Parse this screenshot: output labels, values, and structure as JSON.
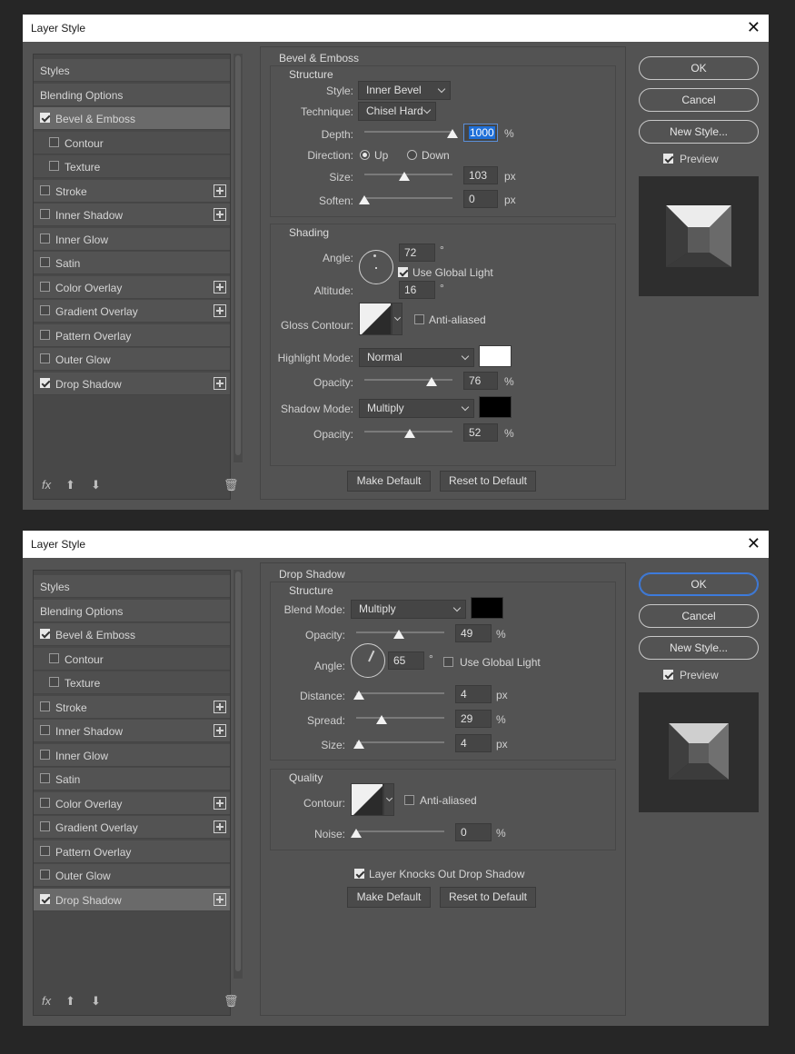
{
  "dialog1": {
    "title": "Layer Style",
    "close_glyph": "✕",
    "styles_list": [
      {
        "label": "Styles"
      },
      {
        "label": "Blending Options"
      },
      {
        "label": "Bevel & Emboss",
        "checked": true,
        "selected": true
      },
      {
        "label": "Contour",
        "checked": false,
        "sub": true
      },
      {
        "label": "Texture",
        "checked": false,
        "sub": true
      },
      {
        "label": "Stroke",
        "checked": false,
        "plus": true
      },
      {
        "label": "Inner Shadow",
        "checked": false,
        "plus": true
      },
      {
        "label": "Inner Glow",
        "checked": false
      },
      {
        "label": "Satin",
        "checked": false
      },
      {
        "label": "Color Overlay",
        "checked": false,
        "plus": true
      },
      {
        "label": "Gradient Overlay",
        "checked": false,
        "plus": true
      },
      {
        "label": "Pattern Overlay",
        "checked": false
      },
      {
        "label": "Outer Glow",
        "checked": false
      },
      {
        "label": "Drop Shadow",
        "checked": true,
        "plus": true
      }
    ],
    "fx_label": "fx",
    "section_title": "Bevel & Emboss",
    "structure": {
      "title": "Structure",
      "style_label": "Style:",
      "style_value": "Inner Bevel",
      "technique_label": "Technique:",
      "technique_value": "Chisel Hard",
      "depth_label": "Depth:",
      "depth_value": "1000",
      "depth_unit": "%",
      "direction_label": "Direction:",
      "direction_up": "Up",
      "direction_down": "Down",
      "size_label": "Size:",
      "size_value": "103",
      "size_unit": "px",
      "soften_label": "Soften:",
      "soften_value": "0",
      "soften_unit": "px"
    },
    "shading": {
      "title": "Shading",
      "angle_label": "Angle:",
      "angle_value": "72",
      "degree": "°",
      "global_light": "Use Global Light",
      "altitude_label": "Altitude:",
      "altitude_value": "16",
      "gloss_label": "Gloss Contour:",
      "anti_aliased": "Anti-aliased",
      "highlight_label": "Highlight Mode:",
      "highlight_value": "Normal",
      "highlight_color": "#ffffff",
      "opacity_label": "Opacity:",
      "highlight_opacity": "76",
      "shadow_label": "Shadow Mode:",
      "shadow_value": "Multiply",
      "shadow_color": "#000000",
      "shadow_opacity": "52",
      "pct": "%"
    },
    "make_default": "Make Default",
    "reset_default": "Reset to Default",
    "ok": "OK",
    "cancel": "Cancel",
    "new_style": "New Style...",
    "preview": "Preview"
  },
  "dialog2": {
    "title": "Layer Style",
    "close_glyph": "✕",
    "styles_list": [
      {
        "label": "Styles"
      },
      {
        "label": "Blending Options"
      },
      {
        "label": "Bevel & Emboss",
        "checked": true
      },
      {
        "label": "Contour",
        "checked": false,
        "sub": true
      },
      {
        "label": "Texture",
        "checked": false,
        "sub": true
      },
      {
        "label": "Stroke",
        "checked": false,
        "plus": true
      },
      {
        "label": "Inner Shadow",
        "checked": false,
        "plus": true
      },
      {
        "label": "Inner Glow",
        "checked": false
      },
      {
        "label": "Satin",
        "checked": false
      },
      {
        "label": "Color Overlay",
        "checked": false,
        "plus": true
      },
      {
        "label": "Gradient Overlay",
        "checked": false,
        "plus": true
      },
      {
        "label": "Pattern Overlay",
        "checked": false
      },
      {
        "label": "Outer Glow",
        "checked": false
      },
      {
        "label": "Drop Shadow",
        "checked": true,
        "plus": true,
        "selected": true
      }
    ],
    "fx_label": "fx",
    "section_title": "Drop Shadow",
    "structure": {
      "title": "Structure",
      "blend_label": "Blend Mode:",
      "blend_value": "Multiply",
      "blend_color": "#000000",
      "opacity_label": "Opacity:",
      "opacity_value": "49",
      "pct": "%",
      "angle_label": "Angle:",
      "angle_value": "65",
      "degree": "°",
      "global_light": "Use Global Light",
      "distance_label": "Distance:",
      "distance_value": "4",
      "px": "px",
      "spread_label": "Spread:",
      "spread_value": "29",
      "size_label": "Size:",
      "size_value": "4"
    },
    "quality": {
      "title": "Quality",
      "contour_label": "Contour:",
      "anti_aliased": "Anti-aliased",
      "noise_label": "Noise:",
      "noise_value": "0"
    },
    "knockout": "Layer Knocks Out Drop Shadow",
    "make_default": "Make Default",
    "reset_default": "Reset to Default",
    "ok": "OK",
    "cancel": "Cancel",
    "new_style": "New Style...",
    "preview": "Preview"
  }
}
